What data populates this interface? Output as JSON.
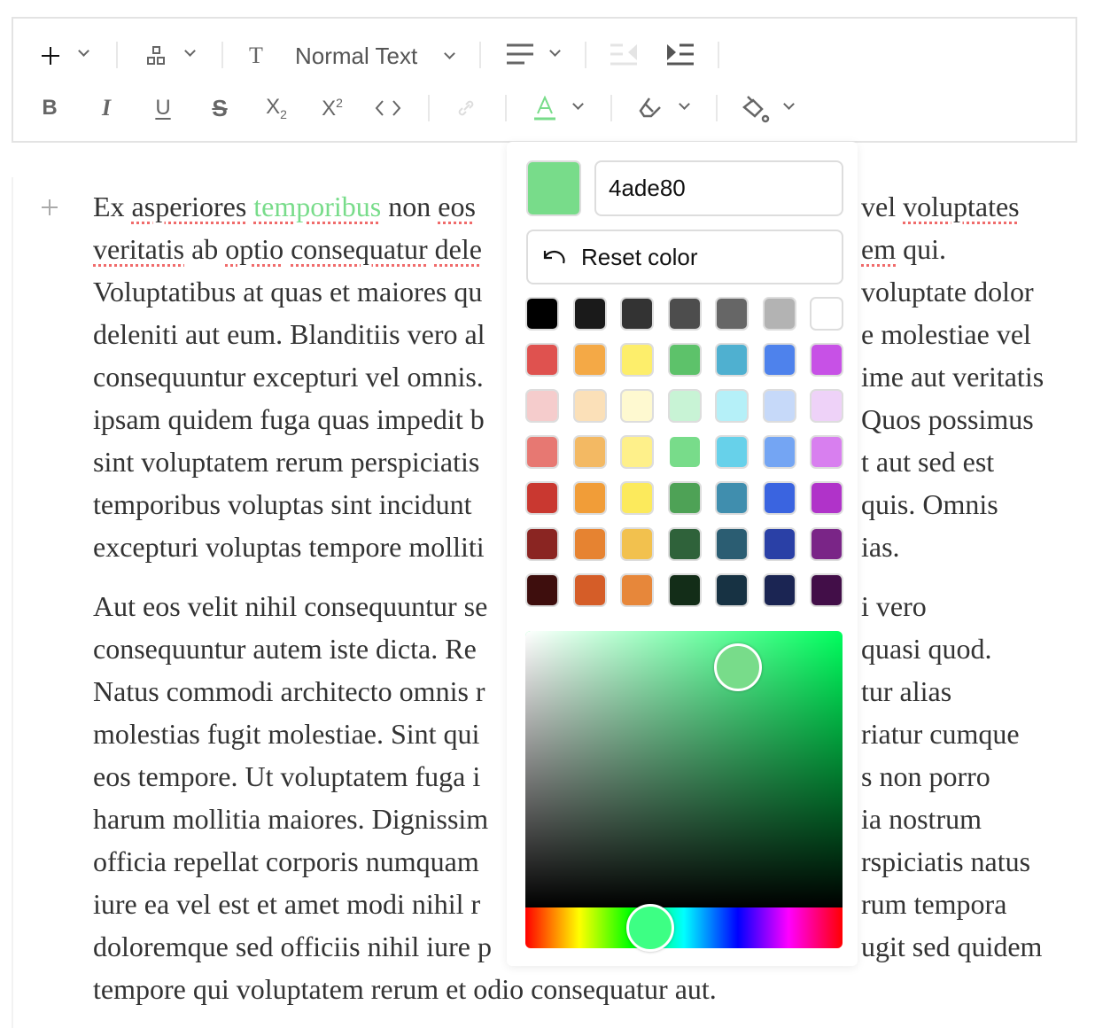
{
  "toolbar": {
    "block_type_label": "Normal Text",
    "text_color": "#78dc8a",
    "icons": [
      "plus-icon",
      "blocks-icon",
      "text-type-icon",
      "align-left-icon",
      "outdent-icon",
      "indent-icon",
      "bold-icon",
      "italic-icon",
      "underline-icon",
      "strikethrough-icon",
      "subscript-icon",
      "superscript-icon",
      "code-icon",
      "link-icon",
      "text-color-icon",
      "highlight-icon",
      "paint-bucket-icon"
    ]
  },
  "editor": {
    "paragraph1": {
      "left": [
        [
          {
            "t": "Ex ",
            "s": 0
          },
          {
            "t": "asperiores",
            "s": 1
          },
          {
            "t": " ",
            "s": 0
          },
          {
            "t": "temporibus",
            "s": 1,
            "g": 1
          },
          {
            "t": " non ",
            "s": 0
          },
          {
            "t": "eos",
            "s": 1
          }
        ],
        [
          {
            "t": "veritatis",
            "s": 1
          },
          {
            "t": " ab ",
            "s": 0
          },
          {
            "t": "optio",
            "s": 1
          },
          {
            "t": " ",
            "s": 0
          },
          {
            "t": "consequatur",
            "s": 1
          },
          {
            "t": " ",
            "s": 0
          },
          {
            "t": "dele",
            "s": 1
          }
        ],
        [
          {
            "t": "Voluptatibus at quas et maiores qu",
            "s": 0
          }
        ],
        [
          {
            "t": "deleniti aut eum. Blanditiis vero al",
            "s": 0
          }
        ],
        [
          {
            "t": "consequuntur excepturi vel omnis.",
            "s": 0
          }
        ],
        [
          {
            "t": "ipsam quidem fuga quas impedit b",
            "s": 0
          }
        ],
        [
          {
            "t": "sint voluptatem rerum perspiciatis",
            "s": 0
          }
        ],
        [
          {
            "t": "temporibus voluptas sint incidunt",
            "s": 0
          }
        ],
        [
          {
            "t": "excepturi voluptas tempore molliti",
            "s": 0
          }
        ]
      ],
      "right": [
        [
          {
            "t": "vel ",
            "s": 0
          },
          {
            "t": "voluptates",
            "s": 1
          }
        ],
        [
          {
            "t": "em",
            "s": 1
          },
          {
            "t": " qui.",
            "s": 0
          }
        ],
        [
          {
            "t": "voluptate dolor",
            "s": 0
          }
        ],
        [
          {
            "t": "e molestiae vel",
            "s": 0
          }
        ],
        [
          {
            "t": "ime aut veritatis",
            "s": 0
          }
        ],
        [
          {
            "t": "Quos possimus",
            "s": 0
          }
        ],
        [
          {
            "t": "t aut sed est",
            "s": 0
          }
        ],
        [
          {
            "t": "quis. Omnis",
            "s": 0
          }
        ],
        [
          {
            "t": "ias.",
            "s": 0
          }
        ]
      ]
    },
    "paragraph2": {
      "left": [
        "Aut eos velit nihil consequuntur se",
        "consequuntur autem iste dicta. Re",
        "Natus commodi architecto omnis r",
        "molestias fugit molestiae. Sint qui",
        "eos tempore. Ut voluptatem fuga i",
        "harum mollitia maiores. Dignissim",
        "officia repellat corporis numquam",
        "iure ea vel est et amet modi nihil r",
        "doloremque sed officiis nihil iure p"
      ],
      "right": [
        "i vero",
        "quasi quod.",
        "tur alias",
        "riatur cumque",
        "s non porro",
        "ia nostrum",
        "rspiciatis natus",
        "rum tempora",
        "ugit sed quidem"
      ],
      "last_line": "tempore qui voluptatem rerum et odio consequatur aut."
    }
  },
  "color_picker": {
    "current_color": "#78dc8a",
    "hex_value": "4ade80",
    "reset_label": "Reset color",
    "hue": 142,
    "saturation": 67,
    "brightness": 87,
    "palette": [
      [
        "#000000",
        "#1a1a1a",
        "#333333",
        "#4d4d4d",
        "#666666",
        "#b3b3b3",
        "#ffffff"
      ],
      [
        "#df524f",
        "#f4a946",
        "#fdee6b",
        "#5dc26a",
        "#4fb0d0",
        "#4e82ec",
        "#c751e6"
      ],
      [
        "#f5cccc",
        "#fbe0b8",
        "#fef9d0",
        "#c8f3d5",
        "#b5f0f8",
        "#c6d9f9",
        "#eed2f8"
      ],
      [
        "#e77872",
        "#f3b963",
        "#fef08a",
        "#78dc8a",
        "#67d1ea",
        "#74a5f3",
        "#d87fef"
      ],
      [
        "#c93830",
        "#f19d38",
        "#fcea5c",
        "#4ea256",
        "#408eae",
        "#3a64e0",
        "#b033c9"
      ],
      [
        "#8a2522",
        "#e68331",
        "#f2c14e",
        "#2f623a",
        "#2b5d72",
        "#2a40a6",
        "#7a2587"
      ],
      [
        "#3e0e0d",
        "#d55d28",
        "#e7873a",
        "#132d18",
        "#173243",
        "#1b2553",
        "#420e48"
      ]
    ]
  }
}
